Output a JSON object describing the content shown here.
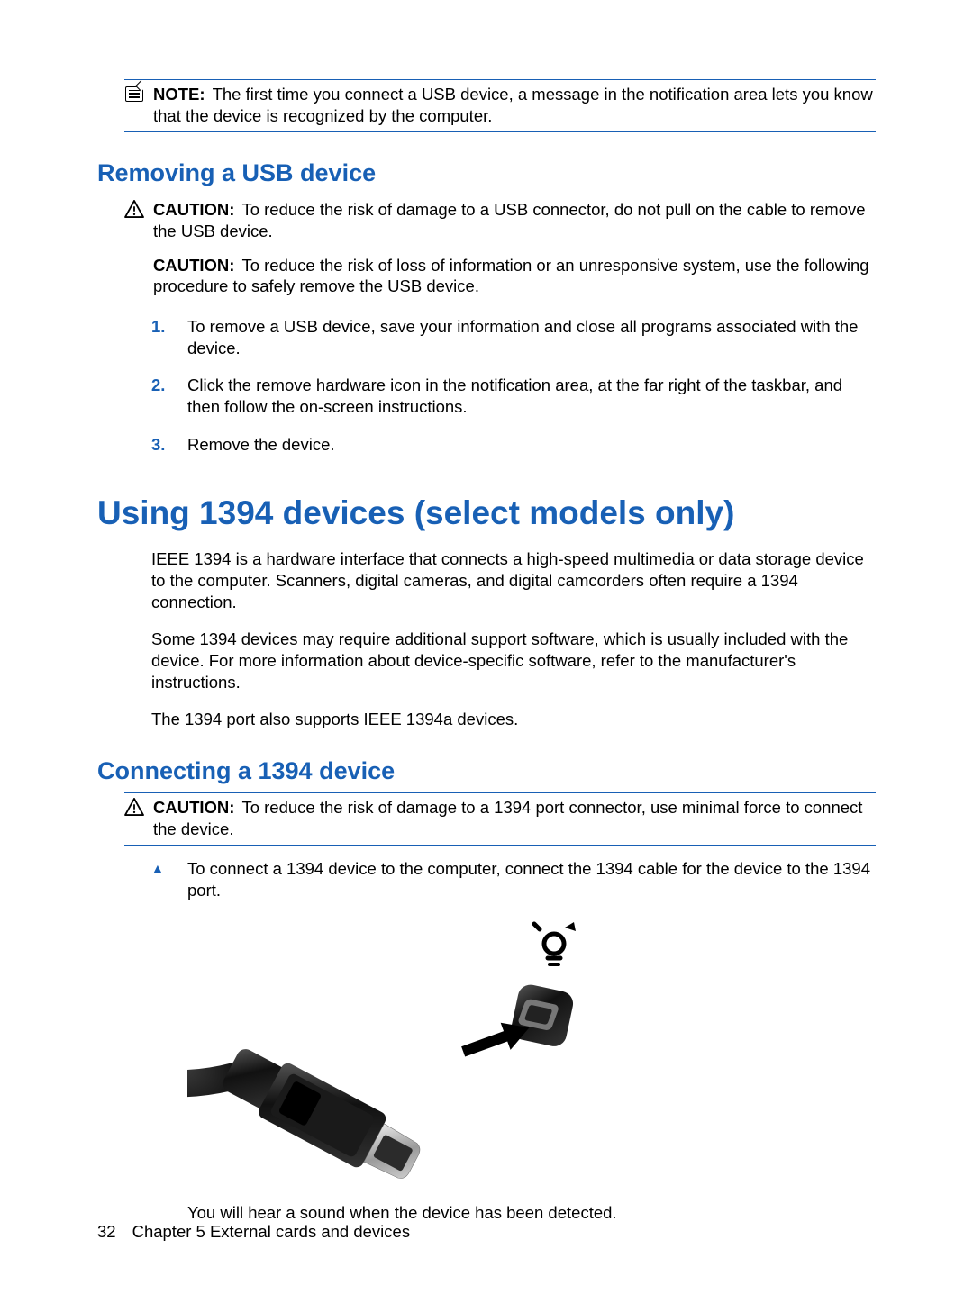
{
  "note_box": {
    "label": "NOTE:",
    "text": "The first time you connect a USB device, a message in the notification area lets you know that the device is recognized by the computer."
  },
  "section_remove": {
    "heading": "Removing a USB device",
    "caution1_label": "CAUTION:",
    "caution1_text": "To reduce the risk of damage to a USB connector, do not pull on the cable to remove the USB device.",
    "caution2_label": "CAUTION:",
    "caution2_text": "To reduce the risk of loss of information or an unresponsive system, use the following procedure to safely remove the USB device.",
    "steps": [
      "To remove a USB device, save your information and close all programs associated with the device.",
      "Click the remove hardware icon in the notification area, at the far right of the taskbar, and then follow the on-screen instructions.",
      "Remove the device."
    ]
  },
  "main_heading": "Using 1394 devices (select models only)",
  "main_paras": [
    "IEEE 1394 is a hardware interface that connects a high-speed multimedia or data storage device to the computer. Scanners, digital cameras, and digital camcorders often require a 1394 connection.",
    "Some 1394 devices may require additional support software, which is usually included with the device. For more information about device-specific software, refer to the manufacturer's instructions.",
    "The 1394 port also supports IEEE 1394a devices."
  ],
  "section_connect": {
    "heading": "Connecting a 1394 device",
    "caution_label": "CAUTION:",
    "caution_text": "To reduce the risk of damage to a 1394 port connector, use minimal force to connect the device.",
    "bullet_text": "To connect a 1394 device to the computer, connect the 1394 cable for the device to the 1394 port.",
    "after_image": "You will hear a sound when the device has been detected."
  },
  "footer": {
    "page_number": "32",
    "chapter": "Chapter 5   External cards and devices"
  },
  "step_numbers": {
    "n1": "1.",
    "n2": "2.",
    "n3": "3."
  },
  "bullet_mark": "▲"
}
